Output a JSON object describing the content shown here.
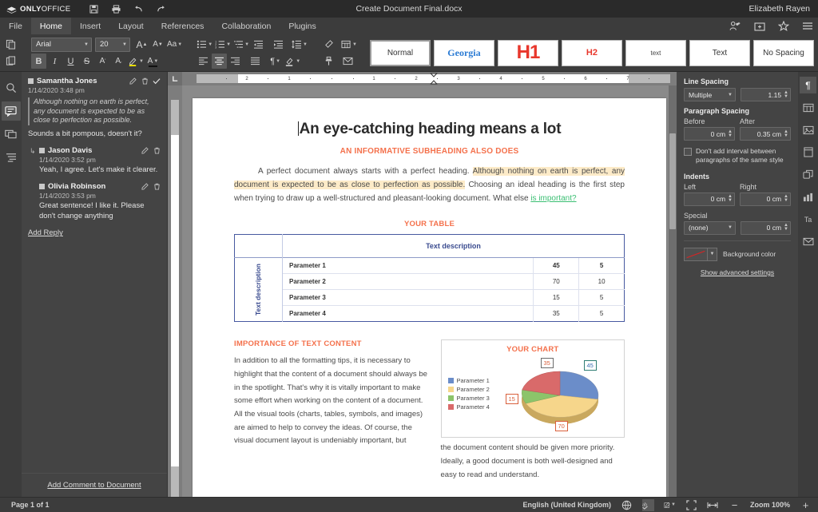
{
  "titlebar": {
    "brand_bold": "ONLY",
    "brand_light": "OFFICE",
    "doc_title": "Create Document Final.docx",
    "user_name": "Elizabeth Rayen",
    "quick_access": [
      {
        "name": "save-icon",
        "glyph": "ὋE"
      },
      {
        "name": "print-icon",
        "glyph": "print"
      },
      {
        "name": "undo-icon",
        "glyph": "undo"
      },
      {
        "name": "redo-icon",
        "glyph": "redo"
      }
    ]
  },
  "menubar": {
    "items": [
      {
        "label": "File",
        "active": false
      },
      {
        "label": "Home",
        "active": true
      },
      {
        "label": "Insert",
        "active": false
      },
      {
        "label": "Layout",
        "active": false
      },
      {
        "label": "References",
        "active": false
      },
      {
        "label": "Collaboration",
        "active": false
      },
      {
        "label": "Plugins",
        "active": false
      }
    ],
    "right_icons": [
      "share-users-icon",
      "open-folder-icon",
      "star-icon",
      "hamburger-menu-icon"
    ]
  },
  "ribbon": {
    "font_name": "Arial",
    "font_size": "20",
    "buttons": {
      "copy": "Copy",
      "paste": "Paste",
      "increase_font": "A",
      "decrease_font": "A",
      "change_case": "Aa",
      "bold": "B",
      "italic": "I",
      "underline": "U",
      "strikethrough": "S",
      "superscript": "A",
      "subscript": "A",
      "highlight": "Highlight color",
      "font_color": "A",
      "bullets": "Bullets",
      "numbering": "Numbering",
      "multilevel": "Multilevel list",
      "decrease_indent": "Decrease indent",
      "increase_indent": "Increase indent",
      "line_spacing": "Line spacing",
      "align_left": "Align left",
      "align_center": "Align center",
      "align_right": "Align right",
      "align_justify": "Justify",
      "nonprinting": "¶",
      "shading": "Shading",
      "clear_style": "Clear style",
      "copy_style": "Copy style",
      "insert_table": "Insert table",
      "mail_merge": "Mail merge"
    },
    "styles": [
      {
        "label": "Normal",
        "kind": "normal",
        "selected": true
      },
      {
        "label": "Georgia",
        "kind": "georgia",
        "selected": false
      },
      {
        "label": "H1",
        "kind": "h1",
        "selected": false
      },
      {
        "label": "H2",
        "kind": "h2",
        "selected": false
      },
      {
        "label": "text",
        "kind": "text-sm",
        "selected": false
      },
      {
        "label": "Text",
        "kind": "text-md",
        "selected": false
      },
      {
        "label": "No Spacing",
        "kind": "nospace",
        "selected": false
      }
    ]
  },
  "left_rail": [
    {
      "name": "search-icon",
      "active": false
    },
    {
      "name": "comments-icon",
      "active": true
    },
    {
      "name": "chat-icon",
      "active": false
    },
    {
      "name": "headings-navigation-icon",
      "active": false
    }
  ],
  "comments": {
    "add_comment_to_document": "Add Comment to Document",
    "thread": {
      "author": "Samantha Jones",
      "date": "1/14/2020 3:48 pm",
      "quote": "Although nothing on earth is perfect, any document is expected to be as close to perfection as possible.",
      "text": "Sounds a bit pompous, doesn't it?",
      "replies": [
        {
          "author": "Jason Davis",
          "date": "1/14/2020 3:52 pm",
          "text": "Yeah, I agree. Let's make it clearer."
        },
        {
          "author": "Olivia Robinson",
          "date": "1/14/2020 3:53 pm",
          "text": "Great sentence! I like it. Please don't change anything"
        }
      ],
      "add_reply": "Add Reply"
    }
  },
  "ruler": {
    "h_ticks": [
      "2",
      "1",
      "1",
      "2",
      "3",
      "4",
      "5",
      "6",
      "7"
    ],
    "v_tick": "17"
  },
  "document": {
    "heading": "An eye-catching heading means a lot",
    "subheading": "AN INFORMATIVE SUBHEADING ALSO DOES",
    "paragraph": {
      "part1": "A perfect document always starts with a perfect heading. ",
      "highlighted": "Although nothing on earth is perfect, any document is expected to be as close to perfection as possible.",
      "part2": " Choosing an ideal heading is the first step when trying to draw up a well-structured and pleasant-looking document. What else ",
      "spellcheck": "is important?"
    },
    "table": {
      "title": "YOUR TABLE",
      "column_header": "Text description",
      "row_header": "Text description",
      "rows": [
        {
          "label": "Parameter 1",
          "v1": "45",
          "v2": "5",
          "bold": true
        },
        {
          "label": "Parameter 2",
          "v1": "70",
          "v2": "10",
          "bold": false
        },
        {
          "label": "Parameter 3",
          "v1": "15",
          "v2": "5",
          "bold": false
        },
        {
          "label": "Parameter 4",
          "v1": "35",
          "v2": "5",
          "bold": false
        }
      ]
    },
    "section": {
      "title": "IMPORTANCE OF TEXT CONTENT",
      "body": "In addition to all the formatting tips, it is necessary to highlight that the content of a document should always be in the spotlight. That's why it is vitally important to make some effort when working on the content of a document. All the visual tools (charts, tables, symbols, and images) are aimed to help to convey the ideas. Of course, the visual document layout is undeniably important, but"
    },
    "after_chart_text": "the document content should be given more priority. Ideally, a good document is both well-designed and easy to read and understand."
  },
  "chart_data": {
    "type": "pie",
    "title": "YOUR CHART",
    "categories": [
      "Parameter 1",
      "Parameter 2",
      "Parameter 3",
      "Parameter 4"
    ],
    "values": [
      45,
      70,
      15,
      35
    ],
    "colors": [
      "#6b8dc9",
      "#f6d68b",
      "#8cc46a",
      "#d96a6a"
    ],
    "label_border_colors": [
      "#2e7d73",
      "#d9603c",
      "#d9603c",
      "#6b6b6b"
    ],
    "data_labels": [
      "45",
      "70",
      "15",
      "35"
    ],
    "legend_position": "left",
    "three_d": true,
    "xlabel": "",
    "ylabel": ""
  },
  "right_panel": {
    "line_spacing_label": "Line Spacing",
    "line_spacing_mode": "Multiple",
    "line_spacing_value": "1.15",
    "paragraph_spacing_label": "Paragraph Spacing",
    "before_label": "Before",
    "before_value": "0 cm",
    "after_label": "After",
    "after_value": "0.35 cm",
    "dont_add_interval": "Don't add interval between paragraphs of the same style",
    "indents_label": "Indents",
    "left_label": "Left",
    "left_value": "0 cm",
    "right_label": "Right",
    "right_value": "0 cm",
    "special_label": "Special",
    "special_value": "(none)",
    "special_amount": "0 cm",
    "background_color_label": "Background color",
    "show_advanced": "Show advanced settings",
    "tabs": [
      {
        "name": "paragraph-settings-tab",
        "glyph": "¶",
        "active": true
      },
      {
        "name": "table-settings-tab",
        "glyph": "table",
        "active": false
      },
      {
        "name": "image-settings-tab",
        "glyph": "image",
        "active": false
      },
      {
        "name": "header-footer-settings-tab",
        "glyph": "header",
        "active": false
      },
      {
        "name": "shape-settings-tab",
        "glyph": "shape",
        "active": false
      },
      {
        "name": "chart-settings-tab",
        "glyph": "chart",
        "active": false
      },
      {
        "name": "text-art-settings-tab",
        "glyph": "Ta",
        "active": false
      },
      {
        "name": "mail-merge-settings-tab",
        "glyph": "mail",
        "active": false
      }
    ]
  },
  "statusbar": {
    "page_of": "Page 1 of 1",
    "language": "English (United Kingdom)",
    "zoom_label": "Zoom 100%",
    "zoom_out": "−",
    "zoom_in": "+",
    "icons": [
      "spelling-globe-icon",
      "spellcheck-icon",
      "track-changes-icon",
      "fit-page-icon",
      "fit-width-icon"
    ]
  }
}
